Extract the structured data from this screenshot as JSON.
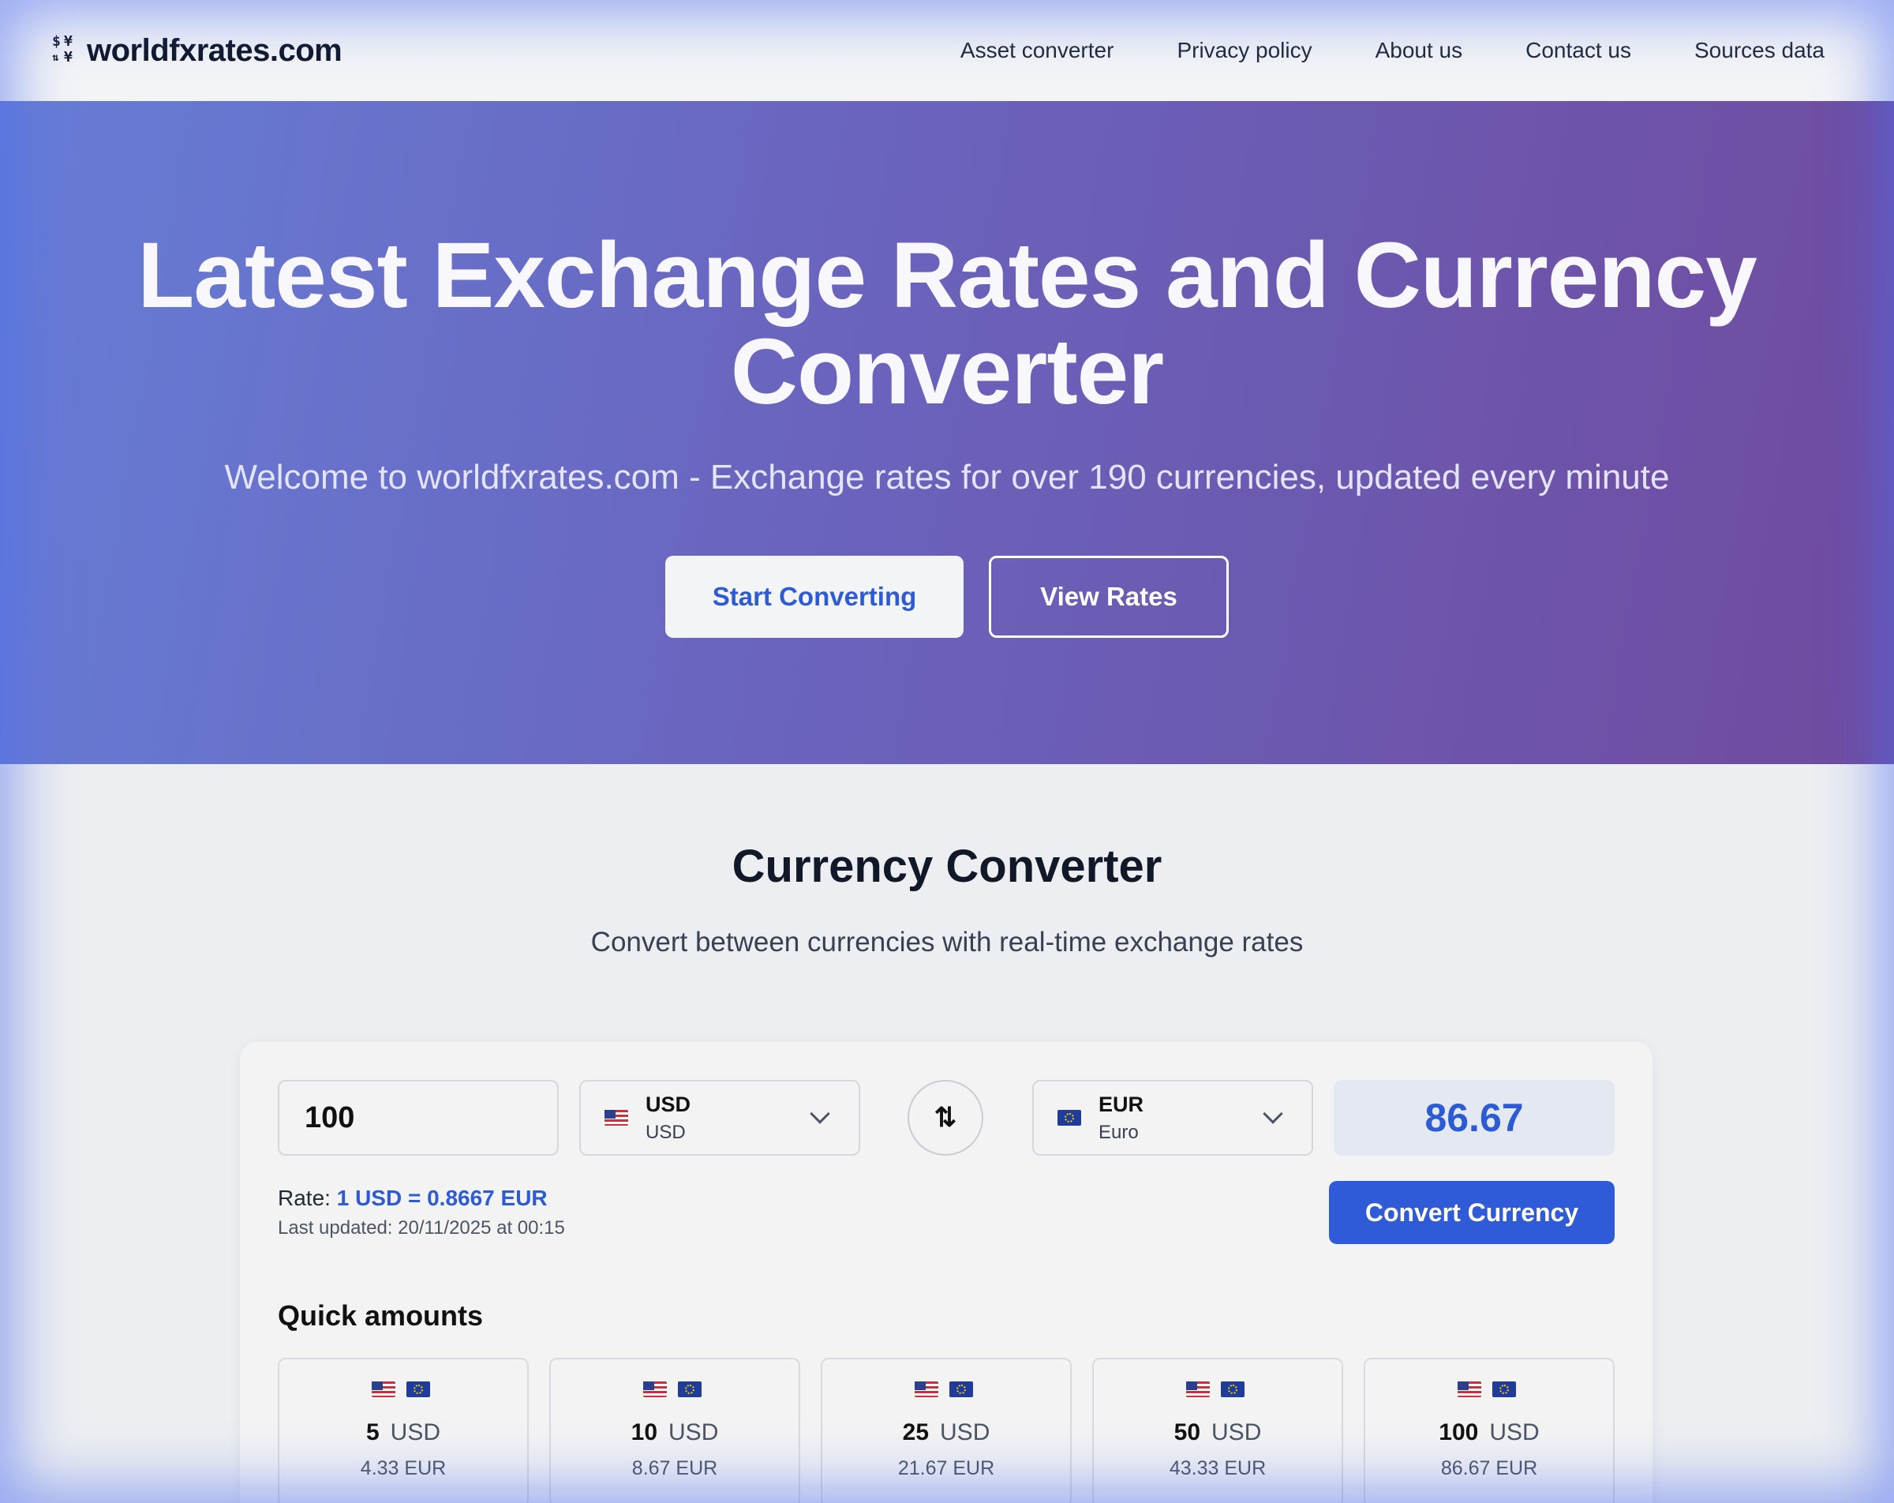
{
  "brand": {
    "name": "worldfxrates.com",
    "icon": "currency-exchange-icon"
  },
  "nav": {
    "links": [
      "Asset converter",
      "Privacy policy",
      "About us",
      "Contact us",
      "Sources data"
    ]
  },
  "hero": {
    "title": "Latest Exchange Rates and Currency Converter",
    "subtitle": "Welcome to worldfxrates.com - Exchange rates for over 190 currencies, updated every minute",
    "primary_button": "Start Converting",
    "secondary_button": "View Rates"
  },
  "converter": {
    "title": "Currency Converter",
    "subtitle": "Convert between currencies with real-time exchange rates",
    "amount": "100",
    "from": {
      "code": "USD",
      "name": "USD",
      "flag": "us-flag-icon"
    },
    "to": {
      "code": "EUR",
      "name": "Euro",
      "flag": "eu-flag-icon"
    },
    "swap_icon": "swap-arrows-icon",
    "result": "86.67",
    "rate_label": "Rate:",
    "rate_value": "1 USD = 0.8667 EUR",
    "last_updated": "Last updated: 20/11/2025 at 00:15",
    "convert_button": "Convert Currency",
    "quick_title": "Quick amounts",
    "quick_amounts": [
      {
        "amount": "5",
        "currency": "USD",
        "result": "4.33 EUR"
      },
      {
        "amount": "10",
        "currency": "USD",
        "result": "8.67 EUR"
      },
      {
        "amount": "25",
        "currency": "USD",
        "result": "21.67 EUR"
      },
      {
        "amount": "50",
        "currency": "USD",
        "result": "43.33 EUR"
      },
      {
        "amount": "100",
        "currency": "USD",
        "result": "86.67 EUR"
      }
    ]
  },
  "colors": {
    "accent": "#2f5bd9",
    "hero_start": "#667dd6",
    "hero_end": "#6f4b9e"
  }
}
